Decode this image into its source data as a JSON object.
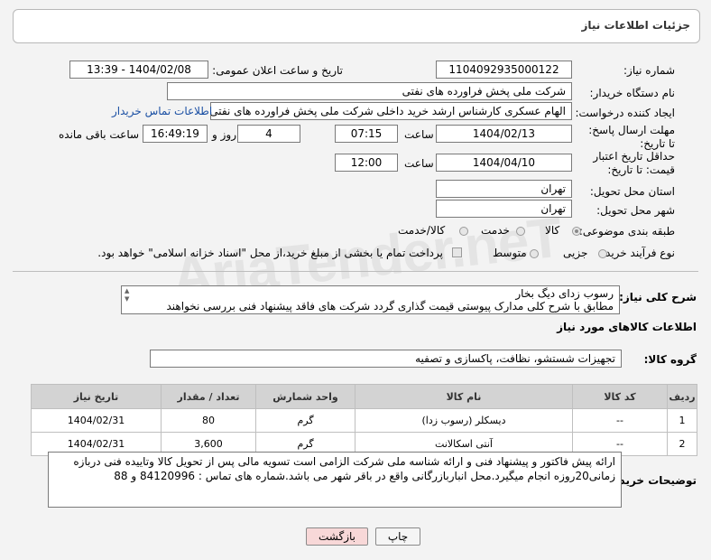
{
  "header": {
    "title": "جزئیات اطلاعات نیاز"
  },
  "fields": {
    "need_number_label": "شماره نیاز:",
    "need_number": "1104092935000122",
    "announce_label": "تاریخ و ساعت اعلان عمومی:",
    "announce_value": "1404/02/08 - 13:39",
    "buyer_label": "نام دستگاه خریدار:",
    "buyer_value": "شرکت ملی پخش فراورده های نفتی",
    "requester_label": "ایجاد کننده درخواست:",
    "requester_value": "الهام عسکری کارشناس ارشد خرید داخلی شرکت ملی پخش فراورده های نفتی",
    "contact_link": "اطلاعات تماس خریدار",
    "reply_deadline_label": "مهلت ارسال پاسخ: تا تاریخ:",
    "reply_date": "1404/02/13",
    "hour_label": "ساعت",
    "reply_time": "07:15",
    "days_value": "4",
    "days_label": "روز و",
    "remaining_time": "16:49:19",
    "remaining_label": "ساعت باقی مانده",
    "price_validity_label": "حداقل تاریخ اعتبار قیمت: تا تاریخ:",
    "price_date": "1404/04/10",
    "price_time": "12:00",
    "province_label": "استان محل تحویل:",
    "province_value": "تهران",
    "city_label": "شهر محل تحویل:",
    "city_value": "تهران",
    "category_label": "طبقه بندی موضوعی:",
    "category_options": [
      "کالا",
      "خدمت",
      "کالا/خدمت"
    ],
    "purchase_type_label": "نوع فرآیند خرید :",
    "purchase_options": [
      "جزیی",
      "متوسط"
    ],
    "payment_note": "پرداخت تمام یا بخشی از مبلغ خرید،از محل \"اسناد خزانه اسلامی\" خواهد بود."
  },
  "description": {
    "label": "شرح کلی نیاز:",
    "line1": "رسوب زدای دیگ بخار",
    "line2": "مطابق با شرح کلی مدارک پیوستی قیمت گذاری گردد شرکت های فاقد پیشنهاد فنی بررسی نخواهند"
  },
  "goods": {
    "section_title": "اطلاعات کالاهای مورد نیاز",
    "group_label": "گروه کالا:",
    "group_value": "تجهیزات شستشو، نظافت، پاکسازی و تصفیه",
    "columns": [
      "ردیف",
      "کد کالا",
      "نام کالا",
      "واحد شمارش",
      "تعداد / مقدار",
      "تاریخ نیاز"
    ],
    "rows": [
      [
        "1",
        "--",
        "دیسکلر (رسوب زدا)",
        "گرم",
        "80",
        "1404/02/31"
      ],
      [
        "2",
        "--",
        "آنتی اسکالانت",
        "گرم",
        "3,600",
        "1404/02/31"
      ]
    ]
  },
  "buyer_notes": {
    "label": "توضیحات خریدار:",
    "text": "ارائه پیش فاکتور و پیشنهاد فنی و ارائه شناسه ملی شرکت الزامی است تسویه مالی پس از تحویل کالا وتاییده فنی دربازه زمانی20روزه انجام میگیرد.محل انباربازرگانی واقع در باقر شهر می باشد.شماره های تماس : 84120996 و 88"
  },
  "buttons": {
    "print": "چاپ",
    "back": "بازگشت"
  },
  "watermark": "AriaTender.neT"
}
